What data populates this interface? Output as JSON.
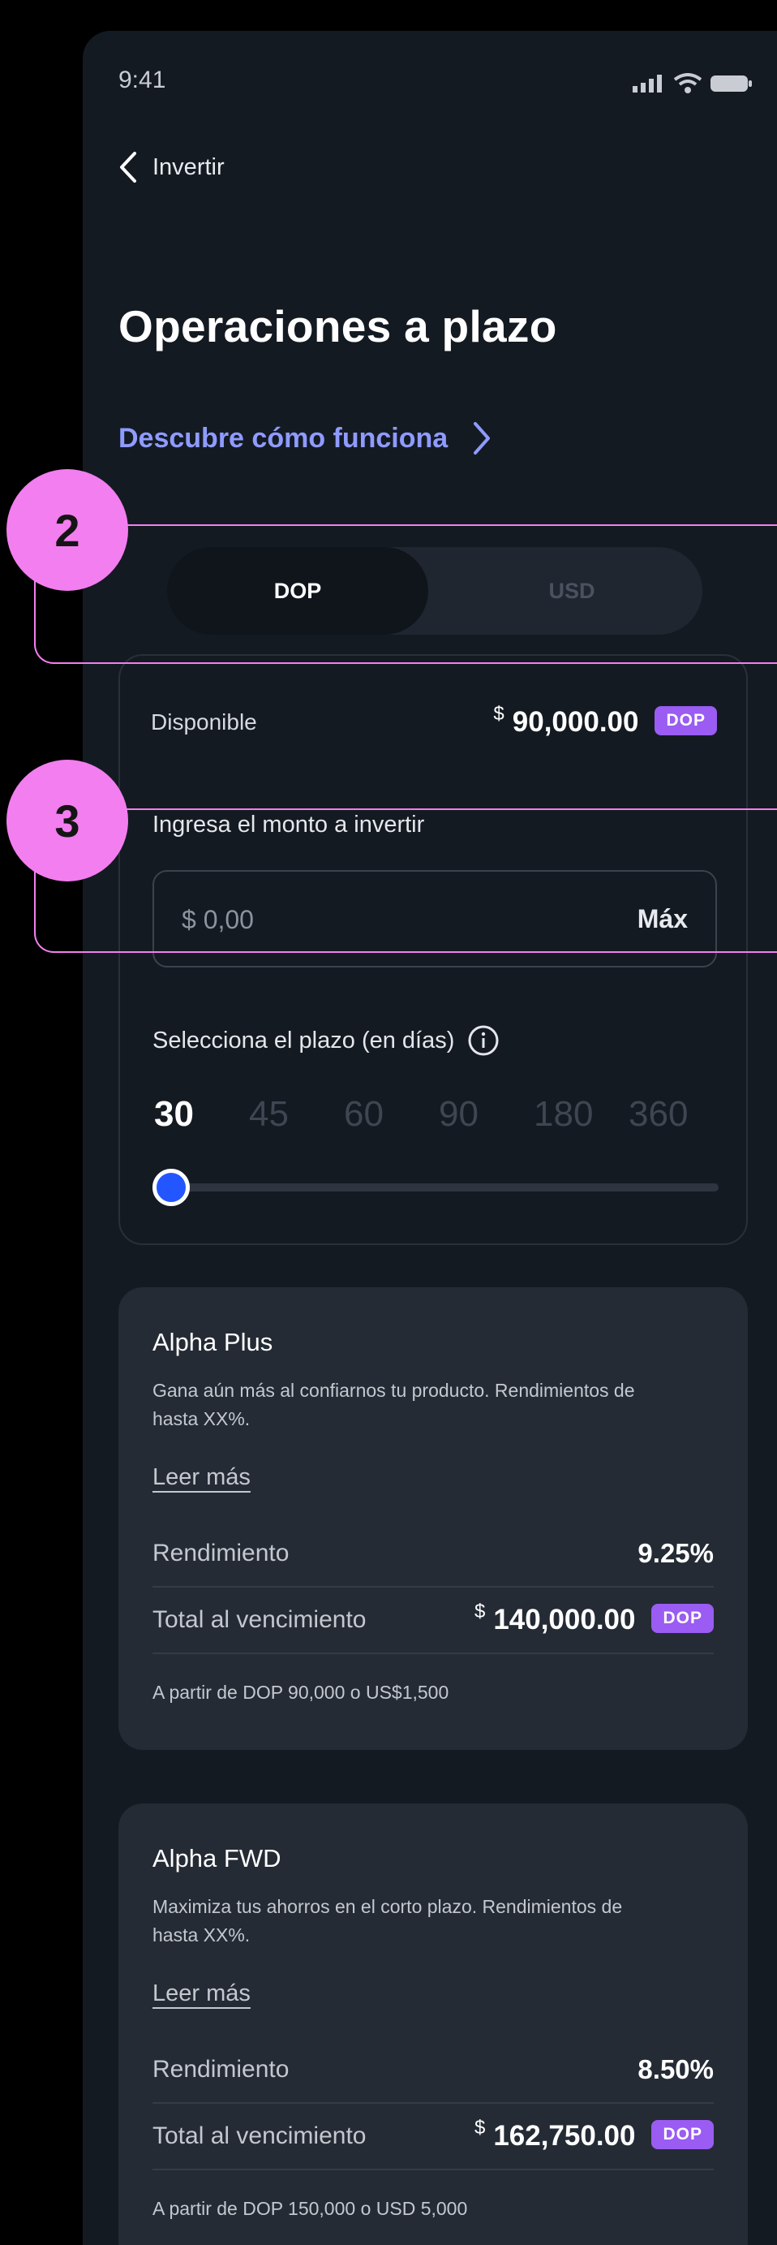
{
  "status_bar": {
    "time": "9:41"
  },
  "nav": {
    "back_label": "Invertir"
  },
  "page": {
    "title": "Operaciones a plazo",
    "discover_label": "Descubre cómo funciona"
  },
  "currency_toggle": {
    "options": [
      "DOP",
      "USD"
    ],
    "selected": "DOP"
  },
  "form": {
    "available_label": "Disponible",
    "available_currency_symbol": "$",
    "available_amount": "90,000.00",
    "available_badge": "DOP",
    "input_label": "Ingresa el monto a invertir",
    "input_placeholder": "$ 0,00",
    "max_label": "Máx",
    "term_label": "Selecciona el plazo (en días)",
    "terms": [
      "30",
      "45",
      "60",
      "90",
      "180",
      "360"
    ],
    "selected_term": "30"
  },
  "plans": [
    {
      "name": "Alpha Plus",
      "description": "Gana aún más al confiarnos tu producto. Rendimientos de hasta XX%.",
      "read_more": "Leer más",
      "yield_label": "Rendimiento",
      "yield_value": "9.25%",
      "total_label": "Total al vencimiento",
      "total_currency_symbol": "$",
      "total_value": "140,000.00",
      "total_badge": "DOP",
      "footnote": "A partir de DOP 90,000 o US$1,500"
    },
    {
      "name": "Alpha FWD",
      "description": "Maximiza tus ahorros en el corto plazo. Rendimientos de hasta XX%.",
      "read_more": "Leer más",
      "yield_label": "Rendimiento",
      "yield_value": "8.50%",
      "total_label": "Total al vencimiento",
      "total_currency_symbol": "$",
      "total_value": "162,750.00",
      "total_badge": "DOP",
      "footnote": "A partir de DOP 150,000 o USD 5,000"
    }
  ],
  "annotations": [
    "2",
    "3"
  ],
  "colors": {
    "accent": "#9a5cf2",
    "link": "#8f9bff",
    "callout": "#f37ef0",
    "slider": "#2456ff"
  }
}
